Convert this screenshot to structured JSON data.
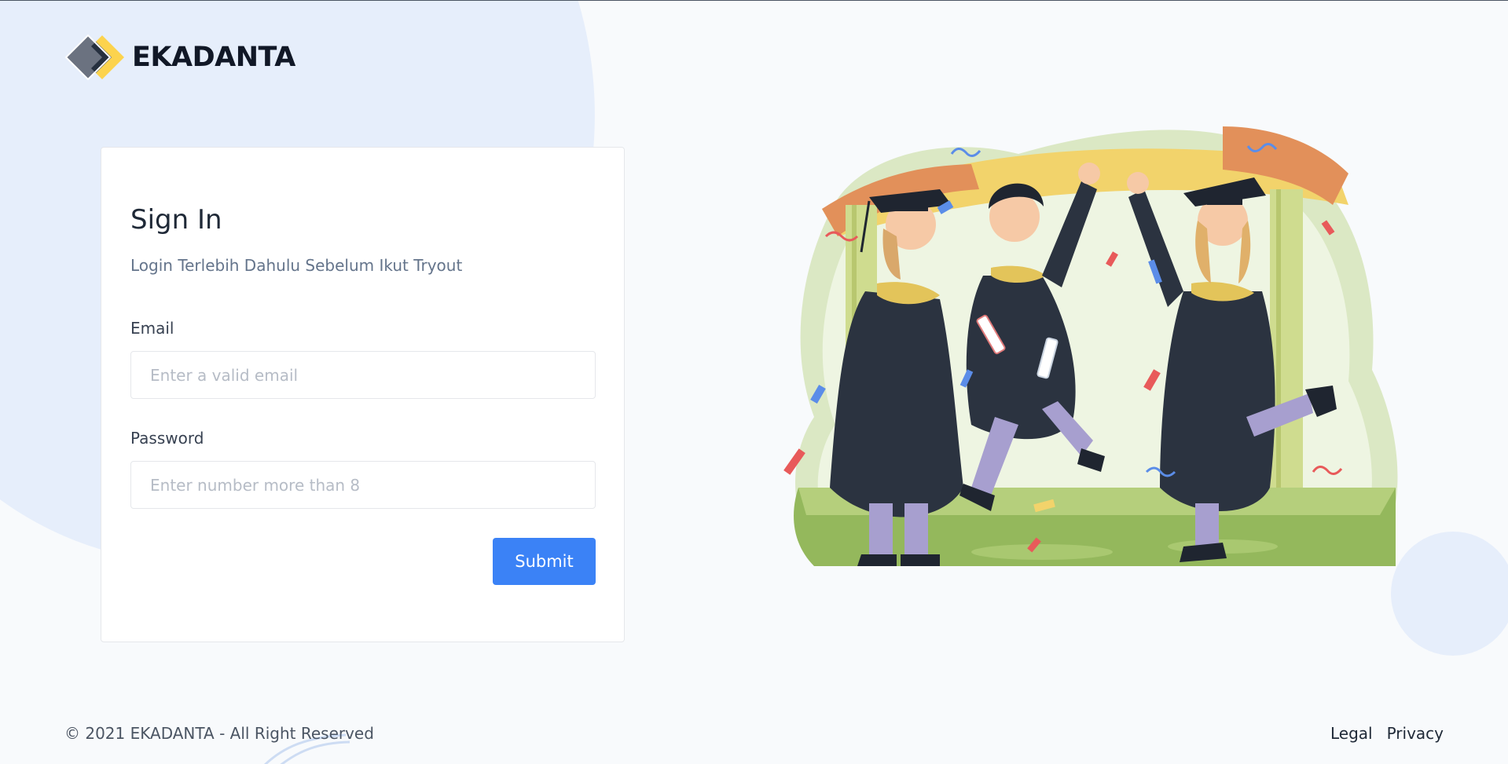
{
  "brand": {
    "name": "EKADANTA"
  },
  "signin": {
    "title": "Sign In",
    "subtitle": "Login Terlebih Dahulu Sebelum Ikut Tryout",
    "email_label": "Email",
    "email_placeholder": "Enter a valid email",
    "email_value": "",
    "password_label": "Password",
    "password_placeholder": "Enter number more than 8",
    "password_value": "",
    "submit_label": "Submit"
  },
  "footer": {
    "copyright": "© 2021 EKADANTA - All Right Reserved",
    "links": [
      "Legal",
      "Privacy"
    ]
  },
  "colors": {
    "accent": "#3b82f6",
    "background": "#f8fafc",
    "blob": "#e6eefb",
    "logo_yellow": "#fcd34d",
    "logo_gray": "#6b7280"
  },
  "icons": {
    "logo": "diamond-chevron-logo-icon",
    "illustration": "graduation-celebration-illustration"
  }
}
